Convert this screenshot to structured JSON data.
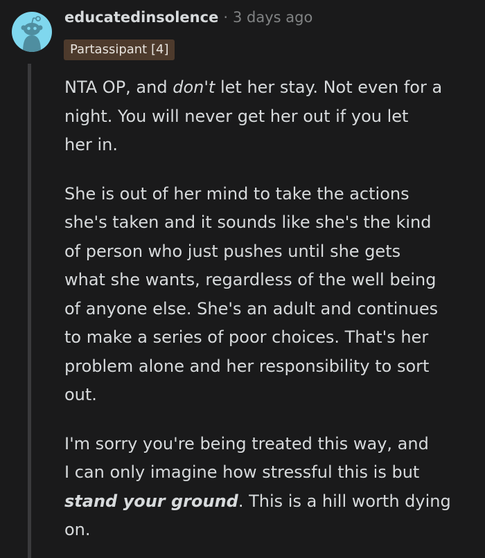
{
  "comment": {
    "username": "educatedinsolence",
    "separator": "·",
    "time": "3 days ago",
    "flair": "Partassipant [4]",
    "avatar_icon": "snoo-avatar-icon",
    "avatar_color": "#7fd7ee",
    "paragraphs": [
      {
        "lines": [
          {
            "parts": [
              "NTA OP, and ",
              "don't",
              " let her stay. Not even for a"
            ]
          },
          {
            "text": "night. You will never get her out if you let"
          },
          {
            "text": "her in."
          }
        ]
      },
      {
        "lines": [
          {
            "text": "She is out of her mind to take the actions"
          },
          {
            "text": "she's taken and it sounds like she's the kind"
          },
          {
            "text": "of person who just pushes until she gets"
          },
          {
            "text": "what she wants, regardless of the well being"
          },
          {
            "text": "of anyone else. She's an adult and continues"
          },
          {
            "text": "to make a series of poor choices. That's her"
          },
          {
            "text": "problem alone and her responsibility to sort"
          },
          {
            "text": "out."
          }
        ]
      },
      {
        "lines": [
          {
            "text": "I'm sorry you're being treated this way, and"
          },
          {
            "text": "I can only imagine how stressful this is but"
          },
          {
            "parts": [
              "stand your ground",
              ". This is a hill worth dying"
            ]
          },
          {
            "text": "on."
          }
        ]
      }
    ]
  }
}
